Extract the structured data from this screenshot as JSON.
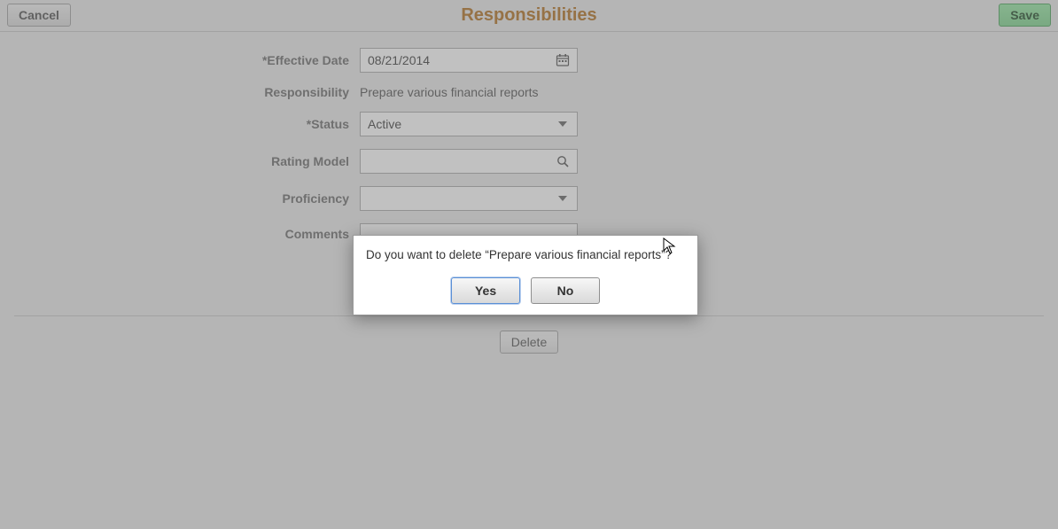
{
  "header": {
    "title": "Responsibilities",
    "cancel_label": "Cancel",
    "save_label": "Save"
  },
  "form": {
    "effective_date": {
      "label": "*Effective Date",
      "value": "08/21/2014"
    },
    "responsibility": {
      "label": "Responsibility",
      "value": "Prepare various financial  reports"
    },
    "status": {
      "label": "*Status",
      "value": "Active"
    },
    "rating_model": {
      "label": "Rating Model",
      "value": ""
    },
    "proficiency": {
      "label": "Proficiency",
      "value": ""
    },
    "comments": {
      "label": "Comments",
      "value": ""
    }
  },
  "actions": {
    "delete_label": "Delete"
  },
  "dialog": {
    "message": "Do you want to delete “Prepare various financial  reports”?",
    "yes_label": "Yes",
    "no_label": "No"
  }
}
